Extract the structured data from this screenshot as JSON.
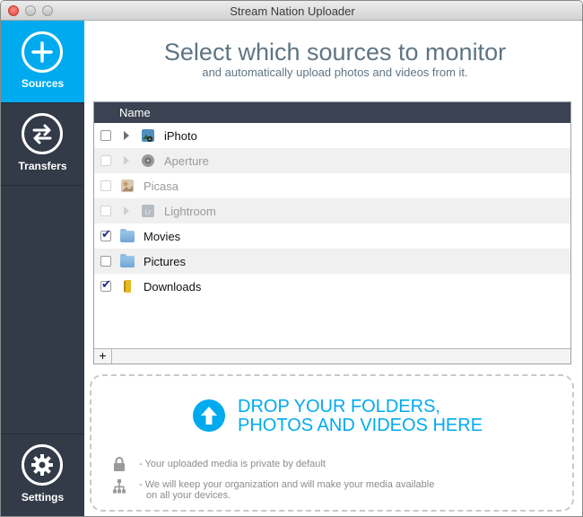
{
  "window": {
    "title": "Stream Nation Uploader"
  },
  "sidebar": {
    "items": [
      {
        "label": "Sources",
        "icon": "plus-icon",
        "active": true
      },
      {
        "label": "Transfers",
        "icon": "transfer-arrows-icon",
        "active": false
      }
    ],
    "settings": {
      "label": "Settings",
      "icon": "gear-icon"
    }
  },
  "header": {
    "title": "Select which sources to monitor",
    "subtitle": "and automatically upload photos and videos from it."
  },
  "table": {
    "column_header": "Name",
    "rows": [
      {
        "label": "iPhoto",
        "checked": false,
        "enabled": true,
        "expandable": true,
        "icon": "iphoto-icon"
      },
      {
        "label": "Aperture",
        "checked": false,
        "enabled": false,
        "expandable": true,
        "icon": "aperture-icon"
      },
      {
        "label": "Picasa",
        "checked": false,
        "enabled": false,
        "expandable": false,
        "icon": "picasa-icon"
      },
      {
        "label": "Lightroom",
        "checked": false,
        "enabled": false,
        "expandable": true,
        "icon": "lightroom-icon"
      },
      {
        "label": "Movies",
        "checked": true,
        "enabled": true,
        "expandable": false,
        "icon": "folder-icon"
      },
      {
        "label": "Pictures",
        "checked": false,
        "enabled": true,
        "expandable": false,
        "icon": "folder-icon"
      },
      {
        "label": "Downloads",
        "checked": true,
        "enabled": true,
        "expandable": false,
        "icon": "downloads-folder-icon"
      }
    ],
    "add_button": "+"
  },
  "dropzone": {
    "line1": "DROP YOUR FOLDERS,",
    "line2": "PHOTOS AND VIDEOS HERE",
    "note_private": "- Your uploaded media is private by default",
    "note_organize_1": "- We will keep your organization and will make your media available",
    "note_organize_2": "on all your devices."
  },
  "colors": {
    "accent": "#00aaee",
    "sidebar": "#333a48",
    "header_text": "#5f7584"
  }
}
